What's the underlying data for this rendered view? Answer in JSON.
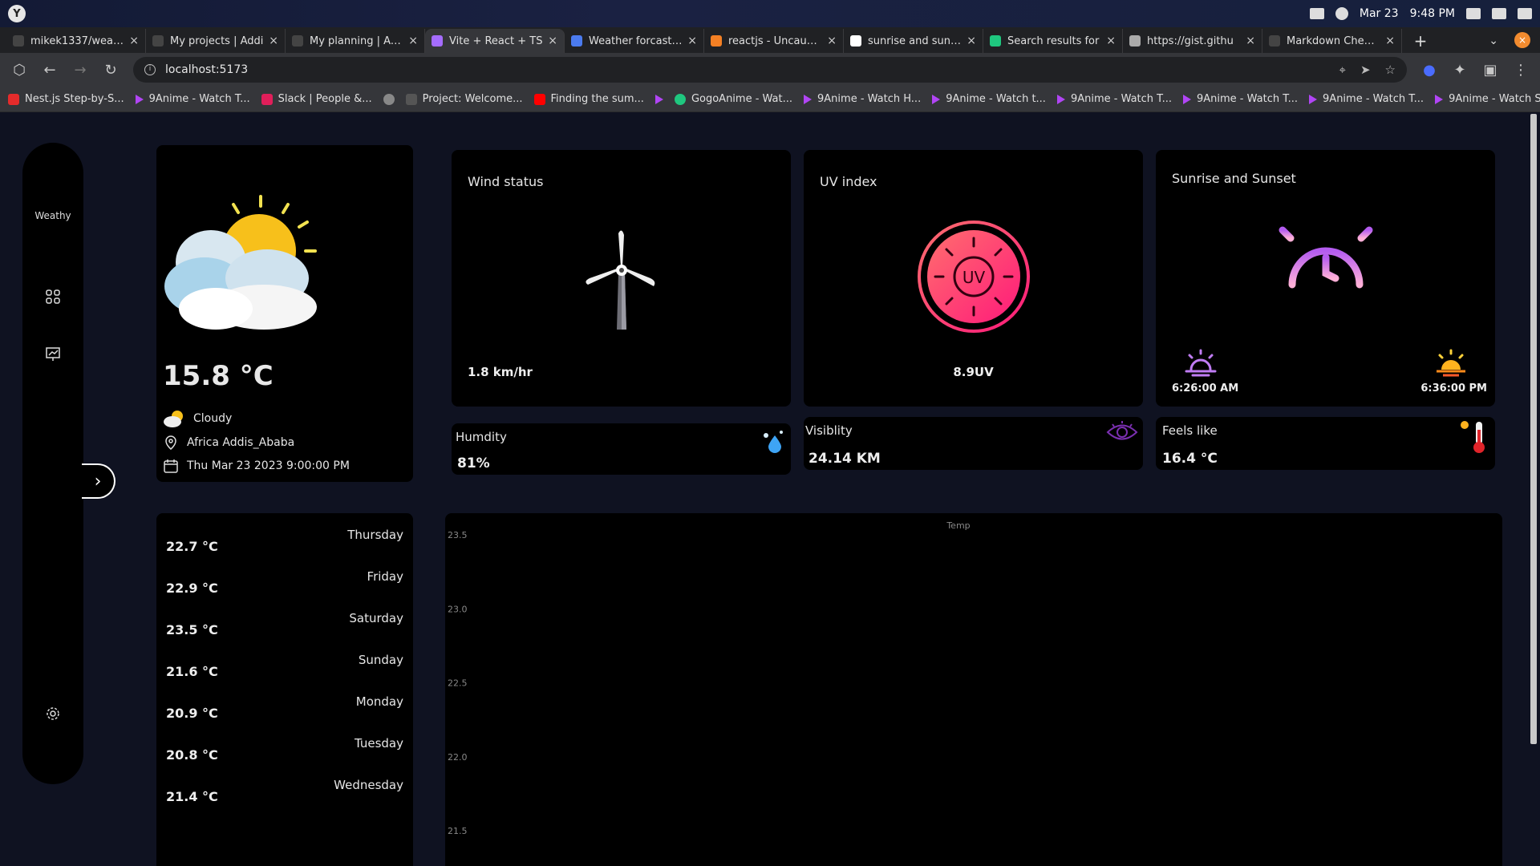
{
  "os": {
    "date": "Mar 23",
    "time": "9:48 PM"
  },
  "tabs": [
    {
      "title": "mikek1337/weathe",
      "color": "#444"
    },
    {
      "title": "My projects | Addi",
      "color": "#444"
    },
    {
      "title": "My planning | Addi",
      "color": "#444"
    },
    {
      "title": "Vite + React + TS",
      "color": "#a56cff",
      "active": true
    },
    {
      "title": "Weather forcast si",
      "color": "#4b7bef"
    },
    {
      "title": "reactjs - Uncaught",
      "color": "#f48024"
    },
    {
      "title": "sunrise and sunse",
      "color": "#ffffff"
    },
    {
      "title": "Search results for",
      "color": "#1fc77f"
    },
    {
      "title": "https://gist.githu",
      "color": "#aaaaaa"
    },
    {
      "title": "Markdown Cheatsh",
      "color": "#444"
    }
  ],
  "toolbar": {
    "url": "localhost:5173"
  },
  "bookmarks": [
    {
      "label": "Nest.js Step-by-S...",
      "kind": "c"
    },
    {
      "label": "9Anime - Watch T...",
      "kind": "tri"
    },
    {
      "label": "Slack | People &...",
      "kind": "slack"
    },
    {
      "label": "",
      "kind": "globe"
    },
    {
      "label": "Project: Welcome...",
      "kind": "gh"
    },
    {
      "label": "Finding the sum...",
      "kind": "yt"
    },
    {
      "label": "",
      "kind": "tri"
    },
    {
      "label": "GogoAnime - Wat...",
      "kind": "gogo"
    },
    {
      "label": "9Anime - Watch H...",
      "kind": "tri"
    },
    {
      "label": "9Anime - Watch t...",
      "kind": "tri"
    },
    {
      "label": "9Anime - Watch T...",
      "kind": "tri"
    },
    {
      "label": "9Anime - Watch T...",
      "kind": "tri"
    },
    {
      "label": "9Anime - Watch T...",
      "kind": "tri"
    },
    {
      "label": "9Anime - Watch S...",
      "kind": "tri"
    }
  ],
  "sidebar": {
    "brand": "Weathy"
  },
  "current": {
    "temp": "15.8 °C",
    "condition": "Cloudy",
    "location": "Africa Addis_Ababa",
    "datetime": "Thu Mar 23 2023 9:00:00 PM"
  },
  "wind": {
    "title": "Wind status",
    "value": "1.8 km/hr"
  },
  "uv": {
    "title": "UV index",
    "value": "8.9UV",
    "badge": "UV"
  },
  "sun": {
    "title": "Sunrise and Sunset",
    "sunrise": "6:26:00 AM",
    "sunset": "6:36:00 PM"
  },
  "humidity": {
    "title": "Humdity",
    "value": "81%"
  },
  "visibility": {
    "title": "Visiblity",
    "value": "24.14 KM"
  },
  "feels": {
    "title": "Feels like",
    "value": "16.4 °C"
  },
  "forecast": [
    {
      "temp": "22.7 °C",
      "day": "Thursday"
    },
    {
      "temp": "22.9 °C",
      "day": "Friday"
    },
    {
      "temp": "23.5 °C",
      "day": "Saturday"
    },
    {
      "temp": "21.6 °C",
      "day": "Sunday"
    },
    {
      "temp": "20.9 °C",
      "day": "Monday"
    },
    {
      "temp": "20.8 °C",
      "day": "Tuesday"
    },
    {
      "temp": "21.4 °C",
      "day": "Wednesday"
    }
  ],
  "chart_data": {
    "type": "line",
    "title": "Temp",
    "xlabel": "",
    "ylabel": "",
    "yticks": [
      "23.5",
      "23.0",
      "22.5",
      "22.0",
      "21.5"
    ],
    "ylim": [
      21.5,
      23.5
    ],
    "grid": false
  }
}
